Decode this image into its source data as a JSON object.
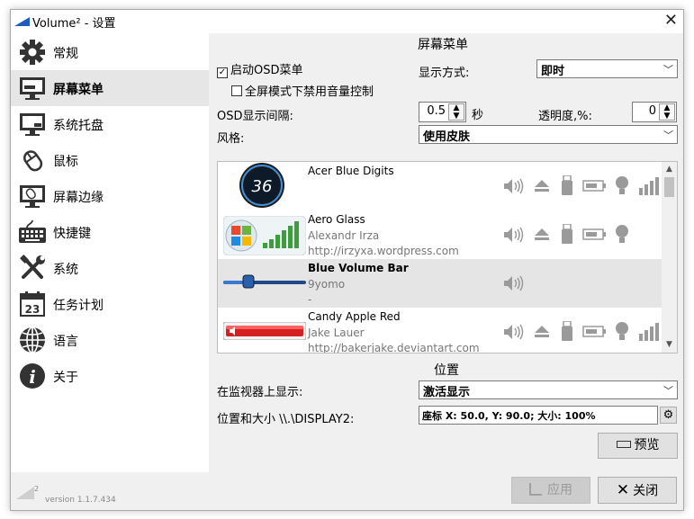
{
  "window": {
    "title": "Volume² - 设置"
  },
  "sidebar": {
    "items": [
      {
        "label": "常规"
      },
      {
        "label": "屏幕菜单"
      },
      {
        "label": "系统托盘"
      },
      {
        "label": "鼠标"
      },
      {
        "label": "屏幕边缘"
      },
      {
        "label": "快捷键"
      },
      {
        "label": "系统"
      },
      {
        "label": "任务计划"
      },
      {
        "label": "语言"
      },
      {
        "label": "关于"
      }
    ],
    "active_index": 1,
    "calendar_day": "23"
  },
  "osd": {
    "section_title": "屏幕菜单",
    "enable_label": "启动OSD菜单",
    "enable_checked": true,
    "fullscreen_label": "全屏模式下禁用音量控制",
    "fullscreen_checked": false,
    "display_mode_label": "显示方式:",
    "display_mode_value": "即时",
    "interval_label": "OSD显示间隔:",
    "interval_value": "0.5",
    "interval_unit": "秒",
    "opacity_label": "透明度,%:",
    "opacity_value": "0",
    "style_label": "风格:",
    "style_value": "使用皮肤"
  },
  "skins": [
    {
      "name": "Acer Blue Digits",
      "author": "",
      "url": "",
      "preview_value": "36",
      "icons": [
        "speaker-icon",
        "eject-icon",
        "usb-icon",
        "battery-icon",
        "bulb-icon",
        "signal-bars-icon"
      ]
    },
    {
      "name": "Aero Glass",
      "author": "Alexandr Irza",
      "url": "http://irzyxa.wordpress.com",
      "icons": [
        "speaker-icon",
        "eject-icon",
        "usb-icon",
        "battery-icon",
        "bulb-icon"
      ]
    },
    {
      "name": "Blue Volume Bar",
      "author": "9yomo",
      "url": "-",
      "icons": [
        "speaker-icon"
      ]
    },
    {
      "name": "Candy Apple Red",
      "author": "Jake Lauer",
      "url": "http://bakerjake.deviantart.com",
      "icons": [
        "speaker-icon",
        "eject-icon",
        "usb-icon",
        "battery-icon",
        "bulb-icon",
        "signal-bars-icon"
      ]
    }
  ],
  "selected_skin_index": 2,
  "position": {
    "section_title": "位置",
    "monitor_label": "在监视器上显示:",
    "monitor_value": "激活显示",
    "pos_label": "位置和大小 \\\\.\\DISPLAY2:",
    "pos_value": "座标 X: 50.0, Y: 90.0; 大小: 100%",
    "preview_button": "预览"
  },
  "footer": {
    "version": "version 1.1.7.434",
    "logo_sup": "2",
    "apply_button": "应用",
    "close_button": "关闭"
  },
  "colors": {
    "accent_blue": "#1e5bbf",
    "signal_green": "#3a9f3a",
    "candy_red": "#d42020",
    "icon_gray": "#9a9a9a"
  }
}
